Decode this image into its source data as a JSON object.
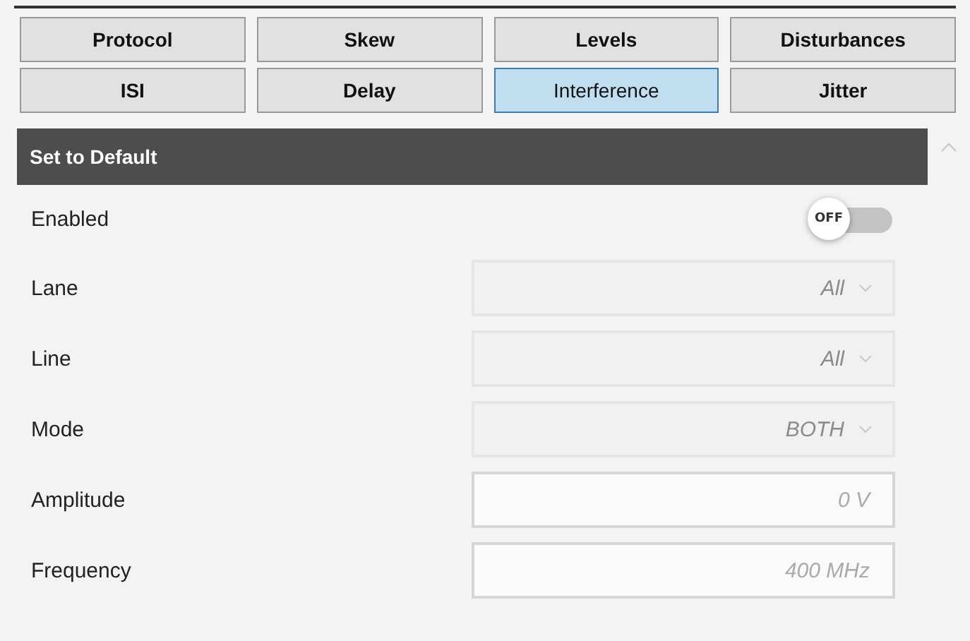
{
  "tabs": [
    {
      "label": "Protocol",
      "selected": false
    },
    {
      "label": "Skew",
      "selected": false
    },
    {
      "label": "Levels",
      "selected": false
    },
    {
      "label": "Disturbances",
      "selected": false
    },
    {
      "label": "ISI",
      "selected": false
    },
    {
      "label": "Delay",
      "selected": false
    },
    {
      "label": "Interference",
      "selected": true
    },
    {
      "label": "Jitter",
      "selected": false
    }
  ],
  "panel": {
    "header": "Set to Default",
    "rows": [
      {
        "kind": "toggle",
        "label": "Enabled",
        "on": false,
        "toggle_text": "OFF"
      },
      {
        "kind": "dropdown",
        "label": "Lane",
        "value": "All",
        "disabled": true
      },
      {
        "kind": "dropdown",
        "label": "Line",
        "value": "All",
        "disabled": true
      },
      {
        "kind": "dropdown",
        "label": "Mode",
        "value": "BOTH",
        "disabled": true
      },
      {
        "kind": "input",
        "label": "Amplitude",
        "placeholder": "0 V"
      },
      {
        "kind": "input",
        "label": "Frequency",
        "placeholder": "400 MHz"
      }
    ]
  }
}
